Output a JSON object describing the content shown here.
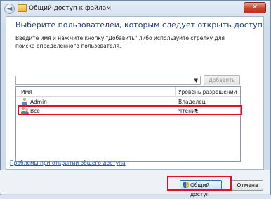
{
  "window": {
    "title": "Общий доступ к файлам",
    "close_glyph": "✕",
    "back_glyph": "◄"
  },
  "dialog": {
    "heading": "Выберите пользователей, которым следует открыть доступ",
    "instruction": "Введите имя и нажмите кнопку \"Добавить\" либо используйте стрелку для поиска определенного пользователя.",
    "user_input": {
      "value": "",
      "placeholder": ""
    },
    "add_label": "Добавить",
    "table": {
      "headers": {
        "name": "Имя",
        "permission": "Уровень разрешений"
      },
      "rows": [
        {
          "name": "Admin",
          "permission": "Владелец",
          "icon": "user-icon"
        },
        {
          "name": "Все",
          "permission": "Чтение",
          "icon": "group-icon",
          "highlighted": true
        }
      ]
    },
    "help_link": "Проблемы при открытии общего доступа"
  },
  "footer": {
    "share_label": "Общий доступ",
    "cancel_label": "Отмена"
  },
  "colors": {
    "highlight": "#e0102a",
    "heading": "#1e3f8a",
    "link": "#1e55b3"
  }
}
